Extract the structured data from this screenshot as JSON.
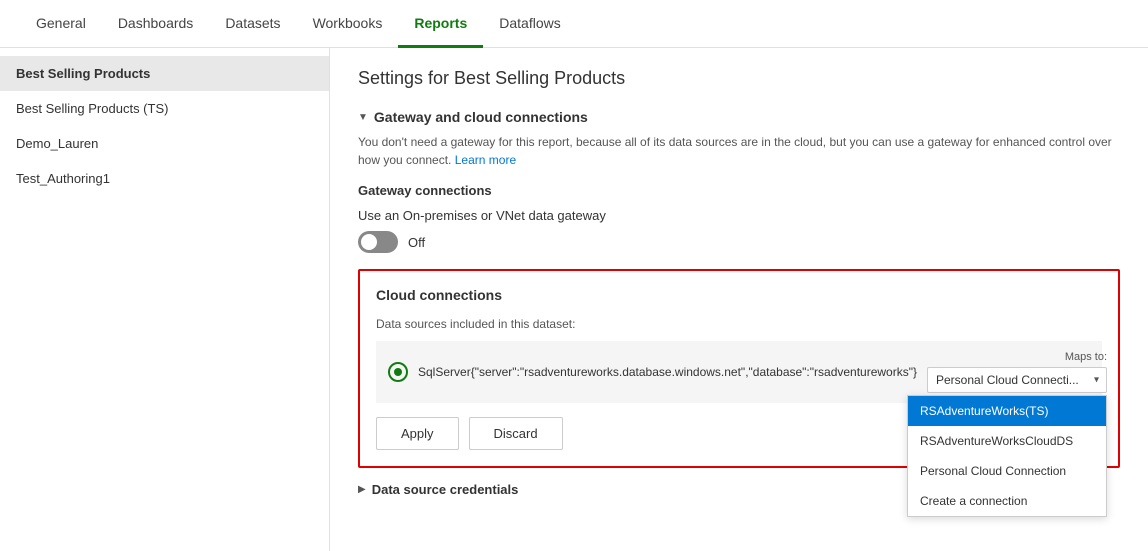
{
  "topNav": {
    "items": [
      {
        "label": "General",
        "active": false
      },
      {
        "label": "Dashboards",
        "active": false
      },
      {
        "label": "Datasets",
        "active": false
      },
      {
        "label": "Workbooks",
        "active": false
      },
      {
        "label": "Reports",
        "active": true
      },
      {
        "label": "Dataflows",
        "active": false
      }
    ]
  },
  "sidebar": {
    "items": [
      {
        "label": "Best Selling Products",
        "active": true
      },
      {
        "label": "Best Selling Products (TS)",
        "active": false
      },
      {
        "label": "Demo_Lauren",
        "active": false
      },
      {
        "label": "Test_Authoring1",
        "active": false
      }
    ]
  },
  "content": {
    "pageTitle": "Settings for Best Selling Products",
    "sections": {
      "gateway": {
        "title": "Gateway and cloud connections",
        "description": "You don't need a gateway for this report, because all of its data sources are in the cloud, but you can use a gateway for enhanced control over how you connect.",
        "learnMoreText": "Learn more",
        "subsectionTitle": "Gateway connections",
        "gatewayRowText": "Use an On-premises or VNet data gateway",
        "toggleLabel": "Off"
      },
      "cloud": {
        "title": "Cloud connections",
        "datasourceLabel": "Data sources included in this dataset:",
        "datasource": {
          "name": "SqlServer{\"server\":\"rsadventureworks.database.windows.net\",\"database\":\"rsadventureworks\"}",
          "mapsToLabel": "Maps to:",
          "selectedOption": "Personal Cloud Connecti..."
        },
        "dropdownOptions": [
          {
            "label": "RSAdventureWorks(TS)",
            "selected": true
          },
          {
            "label": "RSAdventureWorksCloudDS",
            "selected": false
          },
          {
            "label": "Personal Cloud Connection",
            "selected": false
          },
          {
            "label": "Create a connection",
            "selected": false
          }
        ],
        "applyButton": "Apply",
        "discardButton": "Discard"
      },
      "credentials": {
        "title": "Data source credentials"
      }
    }
  }
}
